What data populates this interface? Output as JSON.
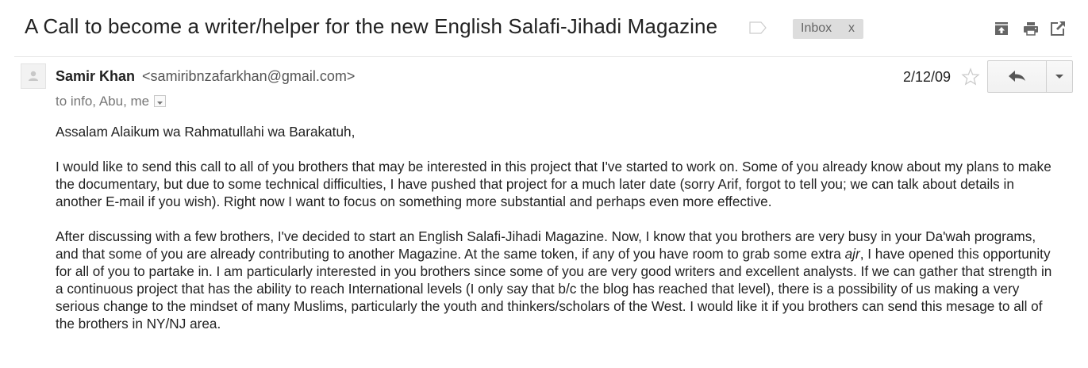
{
  "subject": "A Call to become a writer/helper for the new English Salafi-Jihadi Magazine",
  "label": {
    "name": "Inbox",
    "remove": "x"
  },
  "header_icons": [
    "archive-icon",
    "print-icon",
    "new-window-icon"
  ],
  "message": {
    "sender_name": "Samir Khan",
    "sender_email": "<samiribnzafarkhan@gmail.com>",
    "recipients": "to info, Abu, me",
    "date": "2/12/09"
  },
  "body": {
    "greeting": "Assalam Alaikum wa Rahmatullahi wa Barakatuh,",
    "paragraph1": "I would like to send this call to all of you brothers that may be interested in this project that I've started to work on. Some of you already know about my plans to make the documentary, but due to some technical difficulties, I have pushed that project for a much later date (sorry Arif, forgot to tell you; we can talk about details in another E-mail if you wish). Right now I want to focus on something more substantial and perhaps even more effective.",
    "paragraph2_a": "After discussing with a few brothers, I've decided to start an English Salafi-Jihadi Magazine. Now, I know that you brothers are very busy in your Da'wah programs, and that some of you are already contributing to another Magazine. At the same token, if any of you have room to grab some extra ",
    "paragraph2_italic": "ajr",
    "paragraph2_b": ", I have opened this opportunity for all of you to partake in. I am particularly interested in you brothers since some of you are very good writers and excellent analysts. If we can gather that strength in a continuous project that has the ability to reach International levels (I only say that b/c the blog has reached that level), there is a possibility of us making a very serious change to the mindset of many Muslims, particularly the youth and thinkers/scholars of the West. I would like it if you brothers can send this mesage to all of the brothers in NY/NJ area."
  },
  "colors": {
    "text": "#222222",
    "muted": "#777777",
    "chip_bg": "#dddddd",
    "icon": "#666666"
  }
}
